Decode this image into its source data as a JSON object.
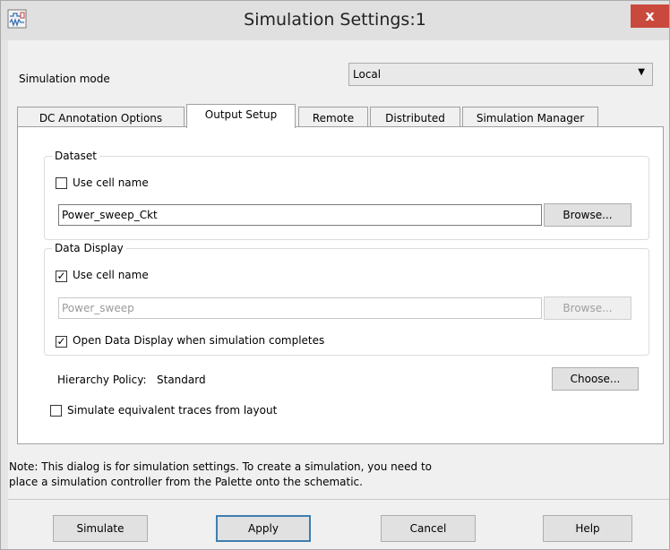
{
  "window": {
    "title": "Simulation Settings:1",
    "close_glyph": "x",
    "app_icon": "schematic-icon"
  },
  "simulation_mode": {
    "label": "Simulation mode",
    "value": "Local"
  },
  "tabs": [
    {
      "label": "DC Annotation Options",
      "active": false
    },
    {
      "label": "Output Setup",
      "active": true
    },
    {
      "label": "Remote",
      "active": false
    },
    {
      "label": "Distributed",
      "active": false
    },
    {
      "label": "Simulation Manager",
      "active": false
    }
  ],
  "dataset": {
    "legend": "Dataset",
    "use_cell_name_label": "Use cell name",
    "use_cell_name_checked": false,
    "name_value": "Power_sweep_Ckt",
    "browse_label": "Browse..."
  },
  "data_display": {
    "legend": "Data Display",
    "use_cell_name_label": "Use cell name",
    "use_cell_name_checked": true,
    "name_value": "Power_sweep",
    "browse_label": "Browse...",
    "open_label": "Open Data Display when simulation completes",
    "open_checked": true
  },
  "hierarchy": {
    "label": "Hierarchy Policy:",
    "value": "Standard",
    "choose_label": "Choose..."
  },
  "simulate_equiv": {
    "label": "Simulate equivalent traces from layout",
    "checked": false
  },
  "note": {
    "line1": "Note: This dialog is for simulation settings. To create a simulation, you need to",
    "line2": "place a simulation controller from the Palette onto the schematic."
  },
  "buttons": {
    "simulate": "Simulate",
    "apply": "Apply",
    "cancel": "Cancel",
    "help": "Help"
  },
  "colors": {
    "close": "#c94a3c",
    "default_button_border": "#3c7fb1"
  }
}
